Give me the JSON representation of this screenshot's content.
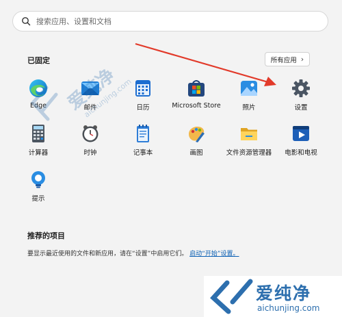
{
  "search": {
    "placeholder": "搜索应用、设置和文档"
  },
  "pinned": {
    "title": "已固定",
    "all_apps_label": "所有应用",
    "apps": [
      {
        "label": "Edge",
        "icon": "edge-icon"
      },
      {
        "label": "邮件",
        "icon": "mail-icon"
      },
      {
        "label": "日历",
        "icon": "calendar-icon"
      },
      {
        "label": "Microsoft Store",
        "icon": "store-icon"
      },
      {
        "label": "照片",
        "icon": "photos-icon"
      },
      {
        "label": "设置",
        "icon": "settings-gear-icon"
      },
      {
        "label": "计算器",
        "icon": "calculator-icon"
      },
      {
        "label": "时钟",
        "icon": "clock-icon"
      },
      {
        "label": "记事本",
        "icon": "notepad-icon"
      },
      {
        "label": "画图",
        "icon": "paint-icon"
      },
      {
        "label": "文件资源管理器",
        "icon": "file-explorer-icon"
      },
      {
        "label": "电影和电视",
        "icon": "movies-tv-icon"
      },
      {
        "label": "提示",
        "icon": "tips-icon"
      }
    ]
  },
  "recommended": {
    "title": "推荐的项目",
    "text": "要显示最近使用的文件和新应用，请在“设置”中启用它们。",
    "link_text": "启动“开始”设置。"
  },
  "watermark": {
    "cn": "爱纯净",
    "url": "aichunjing.com"
  },
  "colors": {
    "background": "#f3f3f3",
    "arrow": "#e23a2a",
    "link": "#0a5fb4",
    "watermark": "#2d6fae"
  }
}
